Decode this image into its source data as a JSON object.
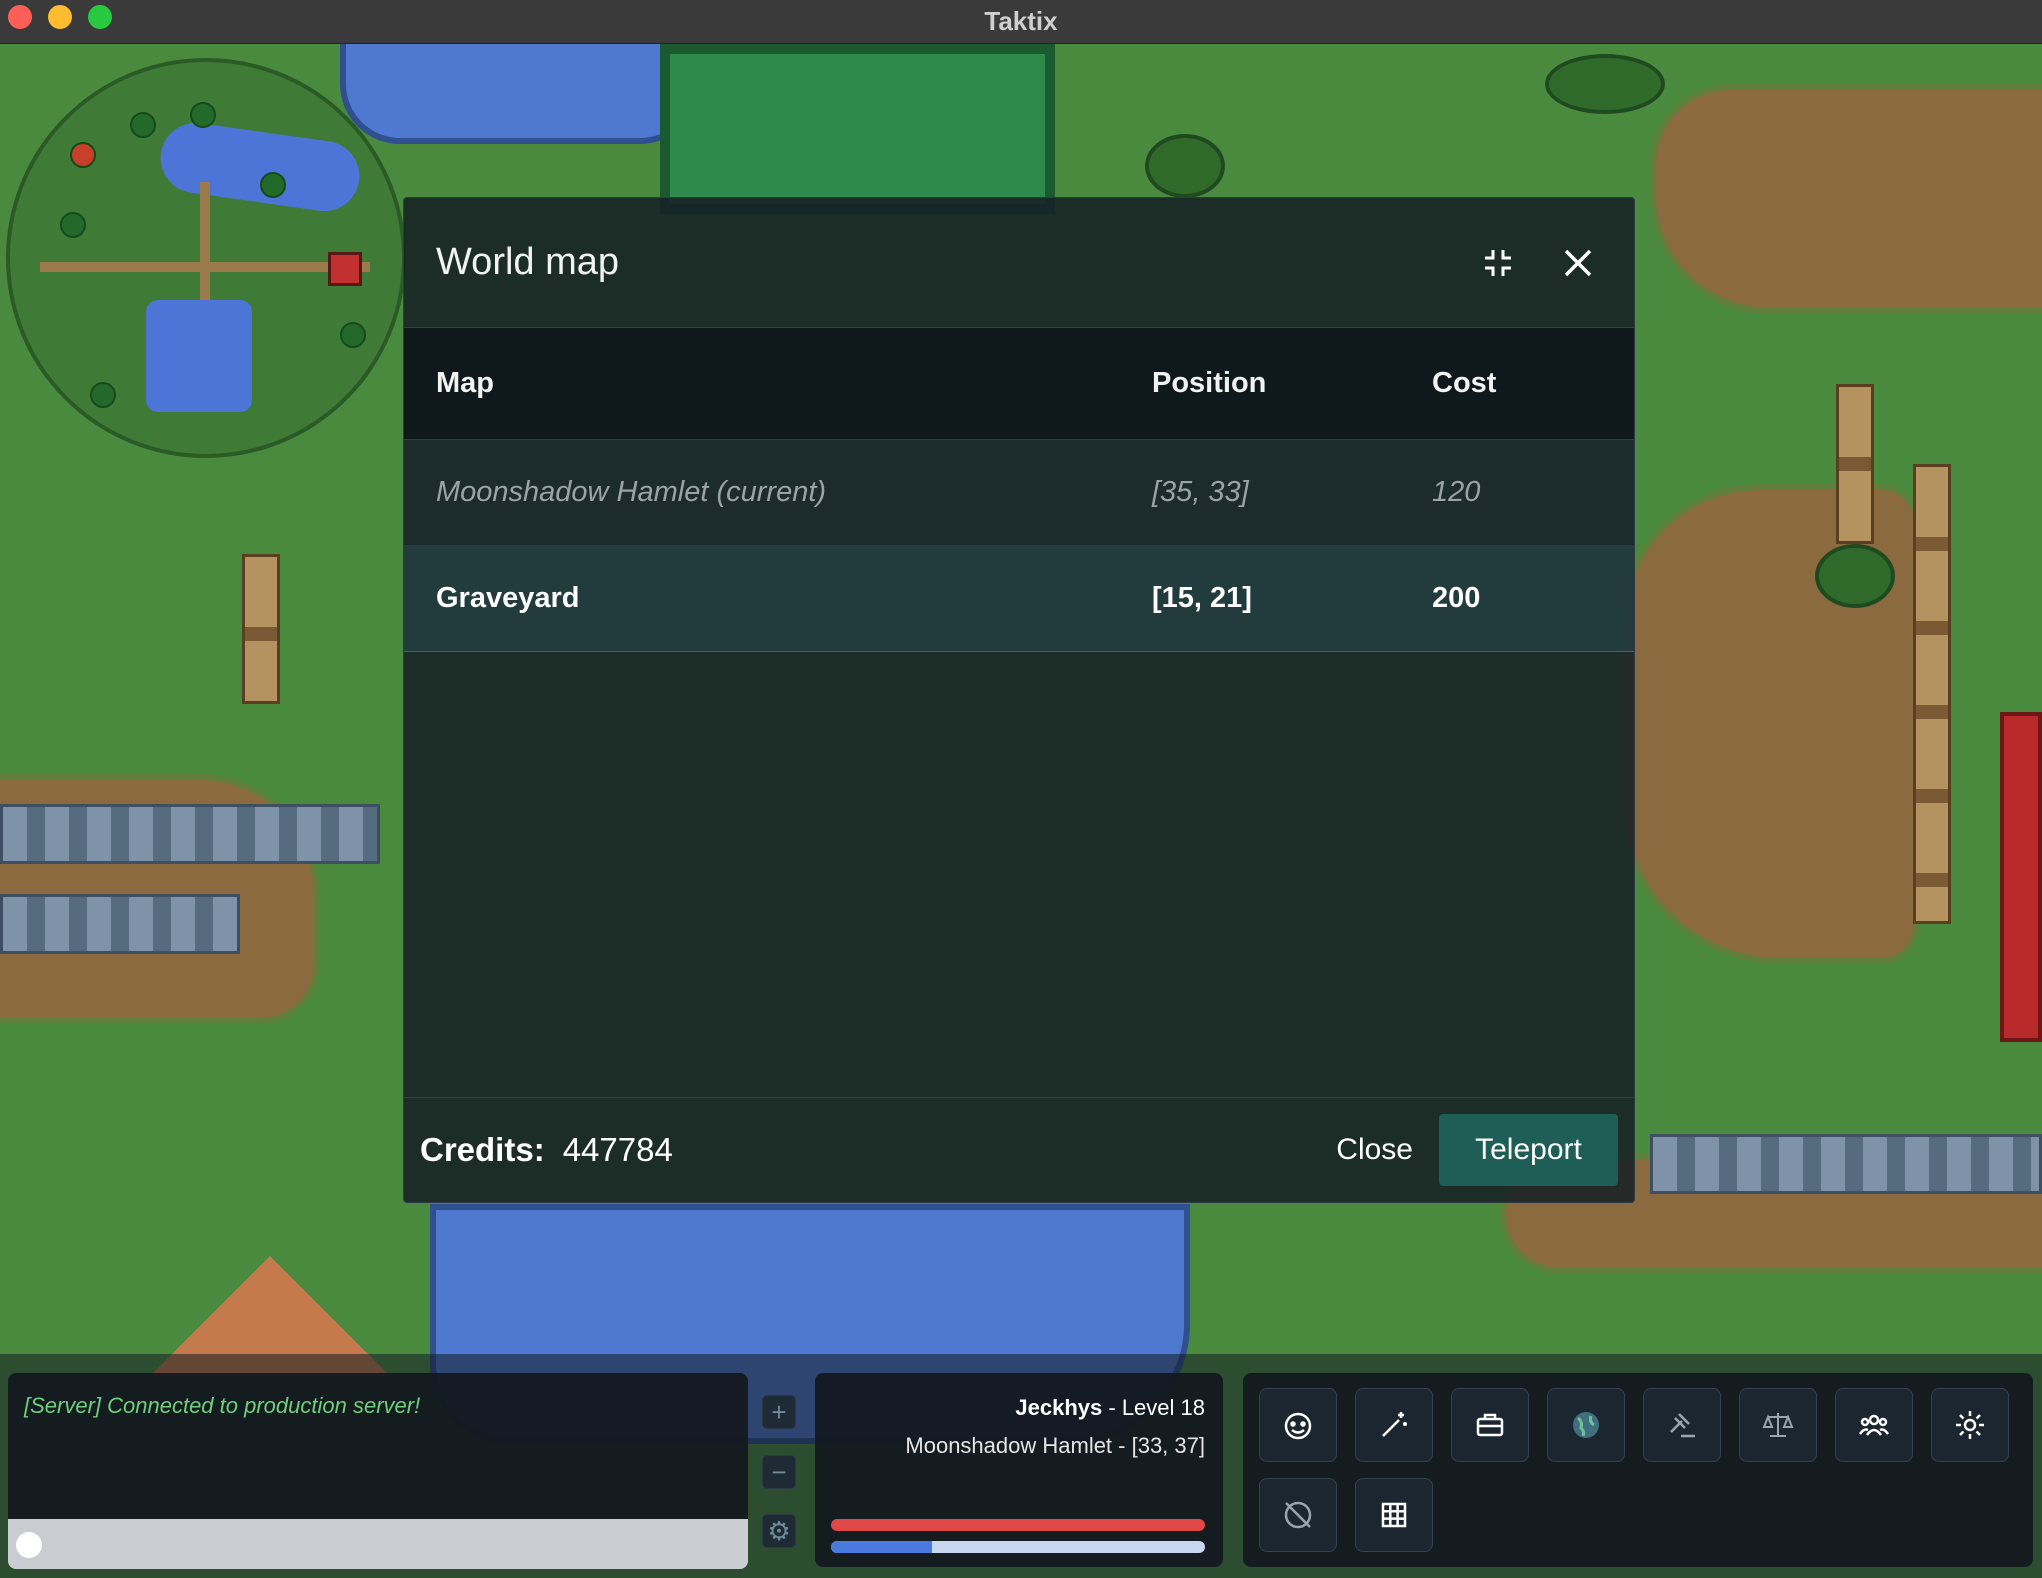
{
  "window": {
    "title": "Taktix"
  },
  "dialog": {
    "title": "World map",
    "columns": {
      "map": "Map",
      "position": "Position",
      "cost": "Cost"
    },
    "rows": [
      {
        "map": "Moonshadow Hamlet (current)",
        "position": "[35, 33]",
        "cost": "120",
        "state": "current"
      },
      {
        "map": "Graveyard",
        "position": "[15, 21]",
        "cost": "200",
        "state": "selected"
      }
    ],
    "credits_label": "Credits:",
    "credits_value": "447784",
    "close_label": "Close",
    "teleport_label": "Teleport"
  },
  "chat": {
    "line": "[Server] Connected to production server!"
  },
  "player": {
    "name": "Jeckhys",
    "level_text": " - Level 18",
    "location": "Moonshadow Hamlet - [33, 37]",
    "health_fraction": 1.0,
    "mana_fraction": 0.27,
    "health_color": "#e04848",
    "mana_color": "#4a7ae0"
  },
  "colors": {
    "teleport_button": "#1f5e56",
    "chat_text": "#6fcf7d"
  },
  "toolbar_icons": [
    "emote-icon",
    "magic-wand-icon",
    "briefcase-icon",
    "globe-icon",
    "gavel-icon",
    "scales-icon",
    "group-icon",
    "settings-icon",
    "hide-globe-icon",
    "grid-icon"
  ]
}
